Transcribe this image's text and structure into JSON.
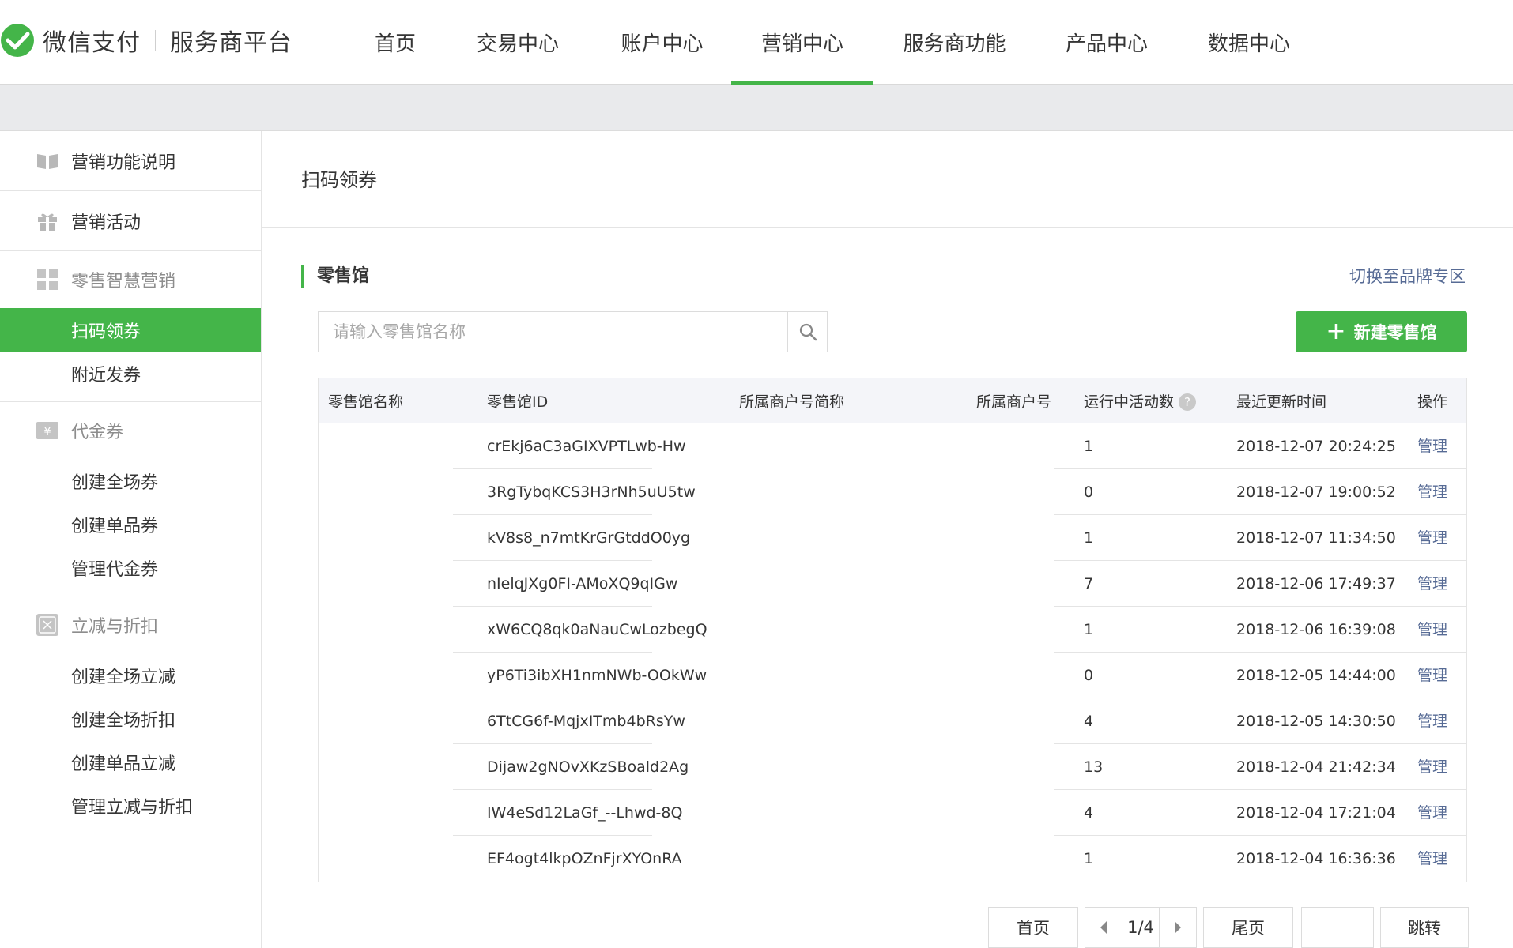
{
  "brand": {
    "name": "微信支付",
    "sub": "服务商平台",
    "green": "#44b549",
    "link": "#576b95"
  },
  "nav": [
    {
      "label": "首页",
      "active": false
    },
    {
      "label": "交易中心",
      "active": false
    },
    {
      "label": "账户中心",
      "active": false
    },
    {
      "label": "营销中心",
      "active": true
    },
    {
      "label": "服务商功能",
      "active": false
    },
    {
      "label": "产品中心",
      "active": false
    },
    {
      "label": "数据中心",
      "active": false
    }
  ],
  "sidebar": {
    "marketing_intro": "营销功能说明",
    "marketing_activity": "营销活动",
    "retail": {
      "title": "零售智慧营销",
      "items": [
        "扫码领券",
        "附近发券"
      ]
    },
    "coupon": {
      "title": "代金券",
      "items": [
        "创建全场券",
        "创建单品券",
        "管理代金券"
      ]
    },
    "discount": {
      "title": "立减与折扣",
      "items": [
        "创建全场立减",
        "创建全场折扣",
        "创建单品立减",
        "管理立减与折扣"
      ]
    }
  },
  "main": {
    "page_title": "扫码领券",
    "section_title": "零售馆",
    "switch_link": "切换至品牌专区",
    "search_placeholder": "请输入零售馆名称",
    "new_button": "新建零售馆",
    "columns": {
      "name": "零售馆名称",
      "id": "零售馆ID",
      "merchant_short": "所属商户号简称",
      "merchant_no": "所属商户号",
      "running": "运行中活动数",
      "updated": "最近更新时间",
      "action": "操作"
    },
    "rows": [
      {
        "id": "crEkj6aC3aGIXVPTLwb-Hw",
        "running": "1",
        "updated": "2018-12-07 20:24:25",
        "action": "管理"
      },
      {
        "id": "3RgTybqKCS3H3rNh5uU5tw",
        "running": "0",
        "updated": "2018-12-07 19:00:52",
        "action": "管理"
      },
      {
        "id": "kV8s8_n7mtKrGrGtddO0yg",
        "running": "1",
        "updated": "2018-12-07 11:34:50",
        "action": "管理"
      },
      {
        "id": "nIelqJXg0FI-AMoXQ9qIGw",
        "running": "7",
        "updated": "2018-12-06 17:49:37",
        "action": "管理"
      },
      {
        "id": "xW6CQ8qk0aNauCwLozbegQ",
        "running": "1",
        "updated": "2018-12-06 16:39:08",
        "action": "管理"
      },
      {
        "id": "yP6Ti3ibXH1nmNWb-OOkWw",
        "running": "0",
        "updated": "2018-12-05 14:44:00",
        "action": "管理"
      },
      {
        "id": "6TtCG6f-MqjxITmb4bRsYw",
        "running": "4",
        "updated": "2018-12-05 14:30:50",
        "action": "管理"
      },
      {
        "id": "Dijaw2gNOvXKzSBoald2Ag",
        "running": "13",
        "updated": "2018-12-04 21:42:34",
        "action": "管理"
      },
      {
        "id": "IW4eSd12LaGf_--Lhwd-8Q",
        "running": "4",
        "updated": "2018-12-04 17:21:04",
        "action": "管理"
      },
      {
        "id": "EF4ogt4lkpOZnFjrXYOnRA",
        "running": "1",
        "updated": "2018-12-04 16:36:36",
        "action": "管理"
      }
    ]
  },
  "pager": {
    "first": "首页",
    "page": "1/4",
    "last": "尾页",
    "jump": "跳转",
    "jump_value": ""
  }
}
